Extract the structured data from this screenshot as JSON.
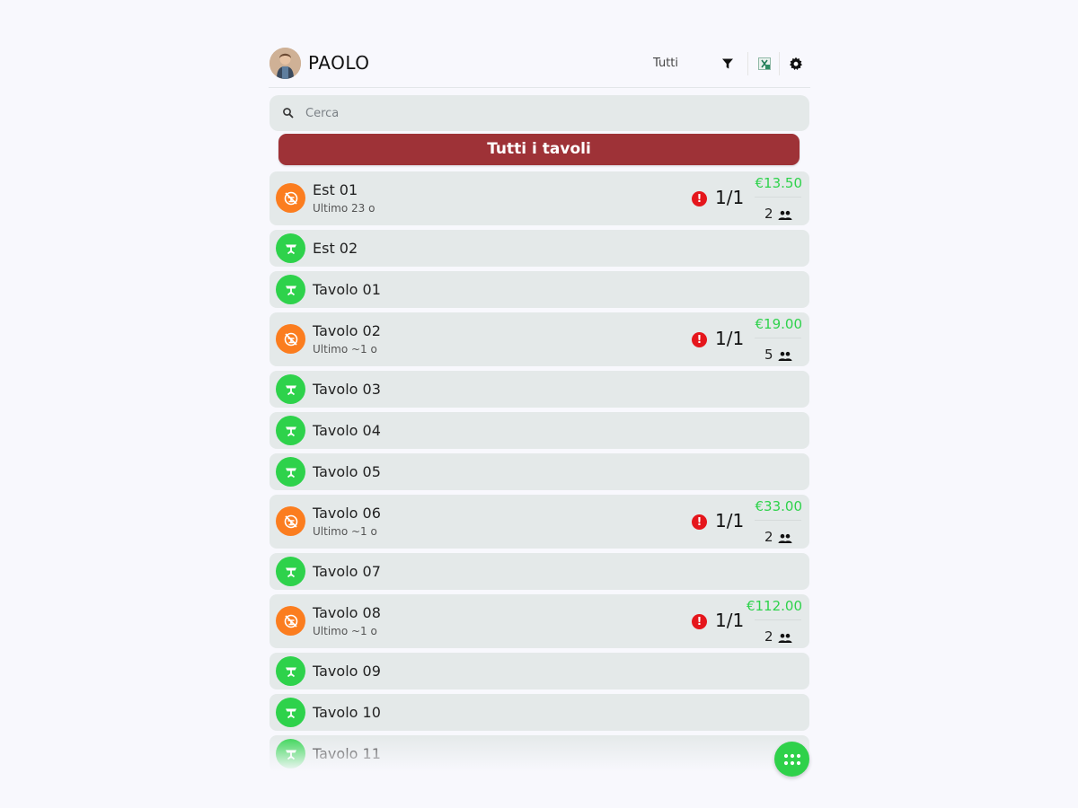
{
  "header": {
    "user_name": "PAOLO",
    "filter_label": "Tutti",
    "icons": [
      "filter-icon",
      "spreadsheet-icon",
      "gear-icon"
    ]
  },
  "search": {
    "placeholder": "Cerca"
  },
  "all_tables_button": {
    "label": "Tutti i tavoli"
  },
  "colors": {
    "brand_red": "#9e3237",
    "occupied": "#fb7d1f",
    "free": "#2ed24b",
    "amount": "#2ed24b",
    "alert": "#e5161c",
    "row_bg": "#e4e9e9"
  },
  "tables": [
    {
      "name": "Est 01",
      "status": "occupied",
      "subtitle": "Ultimo 23 o",
      "ratio": "1/1",
      "amount": "€13.50",
      "guests": "2"
    },
    {
      "name": "Est 02",
      "status": "free"
    },
    {
      "name": "Tavolo 01",
      "status": "free"
    },
    {
      "name": "Tavolo 02",
      "status": "occupied",
      "subtitle": "Ultimo ~1 o",
      "ratio": "1/1",
      "amount": "€19.00",
      "guests": "5"
    },
    {
      "name": "Tavolo 03",
      "status": "free"
    },
    {
      "name": "Tavolo 04",
      "status": "free"
    },
    {
      "name": "Tavolo 05",
      "status": "free"
    },
    {
      "name": "Tavolo 06",
      "status": "occupied",
      "subtitle": "Ultimo ~1 o",
      "ratio": "1/1",
      "amount": "€33.00",
      "guests": "2"
    },
    {
      "name": "Tavolo 07",
      "status": "free"
    },
    {
      "name": "Tavolo 08",
      "status": "occupied",
      "subtitle": "Ultimo ~1 o",
      "ratio": "1/1",
      "amount": "€112.00",
      "guests": "2"
    },
    {
      "name": "Tavolo 09",
      "status": "free"
    },
    {
      "name": "Tavolo 10",
      "status": "free"
    },
    {
      "name": "Tavolo 11",
      "status": "free"
    }
  ],
  "fab": {
    "icon": "grid-menu-icon"
  }
}
